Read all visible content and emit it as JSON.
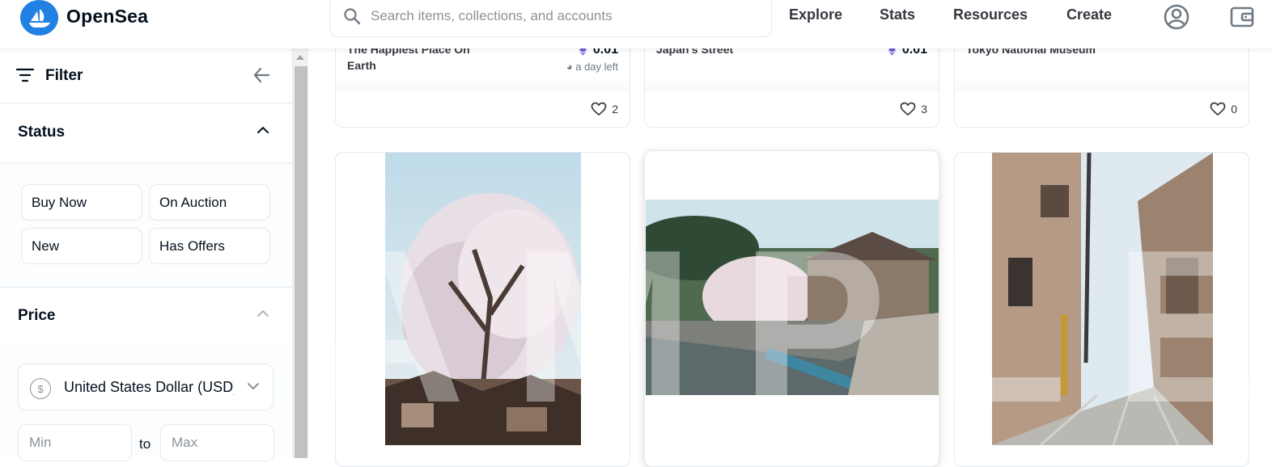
{
  "header": {
    "brand": "OpenSea",
    "search_placeholder": "Search items, collections, and accounts",
    "nav": [
      "Explore",
      "Stats",
      "Resources",
      "Create"
    ]
  },
  "sidebar": {
    "filter_label": "Filter",
    "status": {
      "title": "Status",
      "options": [
        "Buy Now",
        "On Auction",
        "New",
        "Has Offers"
      ]
    },
    "price": {
      "title": "Price",
      "currency": "United States Dollar (USD)",
      "currency_symbol": "$",
      "min_placeholder": "Min",
      "max_placeholder": "Max",
      "to_label": "to"
    }
  },
  "cards_top": [
    {
      "name": "The Happiest Place On Earth",
      "price": "0.01",
      "time_left": "a day left",
      "likes": "2"
    },
    {
      "name": "Japan's Street",
      "price": "0.01",
      "likes": "3"
    },
    {
      "name": "Tokyo National Museum",
      "likes": "0"
    }
  ],
  "watermark": "AMPLE",
  "colors": {
    "brand": "#2081e2",
    "eth": "#6d5bd0",
    "border": "#e5e8eb"
  }
}
